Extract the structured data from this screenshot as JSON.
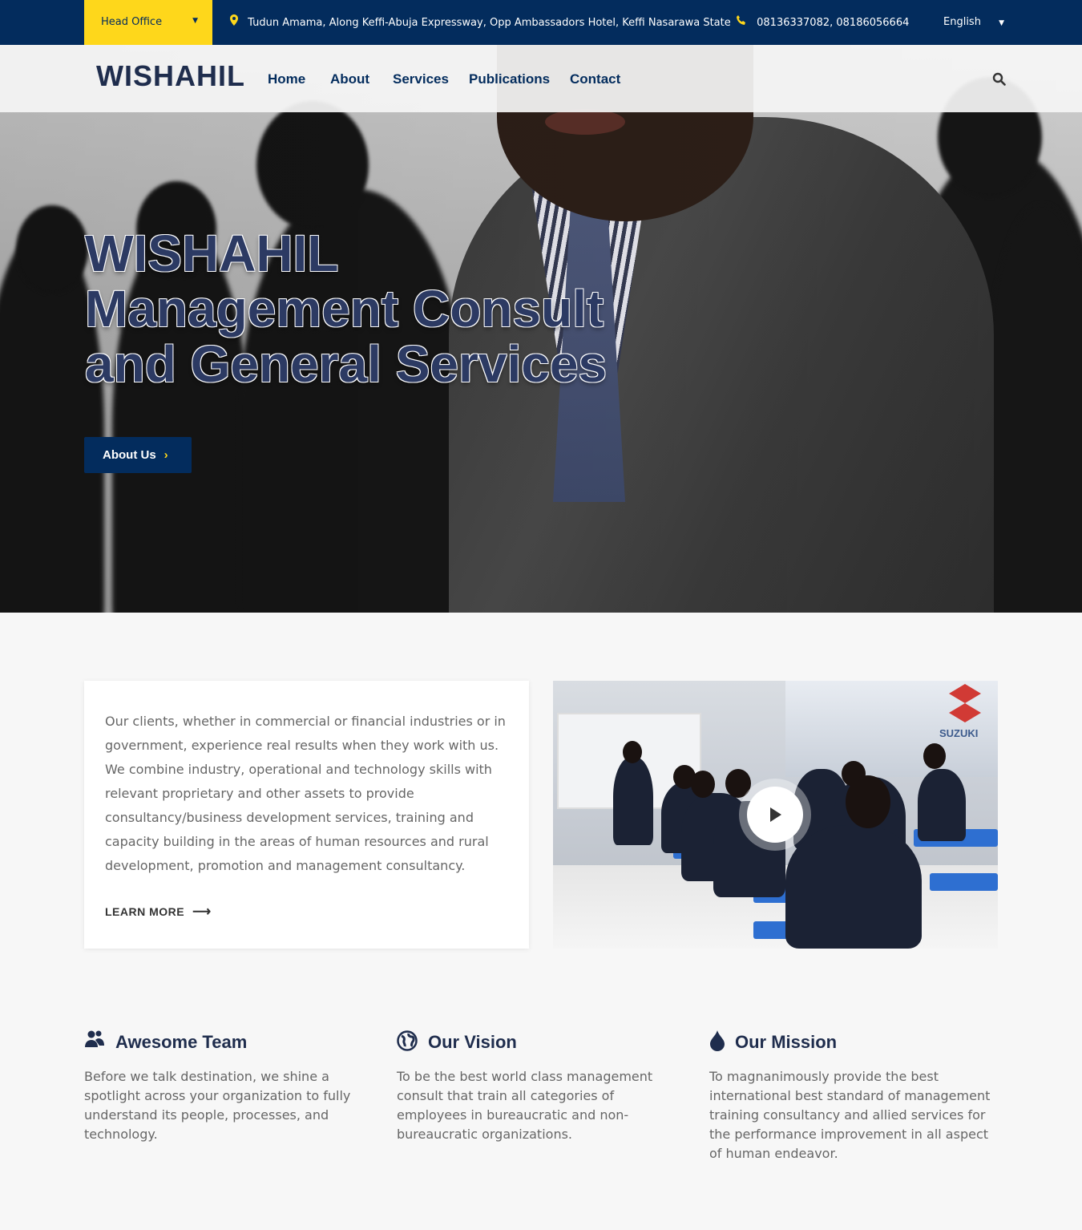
{
  "topbar": {
    "office": "Head Office",
    "address": "Tudun Amama, Along Keffi-Abuja Expressway, Opp Ambassadors Hotel, Keffi Nasarawa State",
    "phone": "08136337082, 08186056664",
    "language": "English"
  },
  "nav": {
    "logo": "WISHAHIL",
    "items": [
      "Home",
      "About",
      "Services",
      "Publications",
      "Contact"
    ]
  },
  "hero": {
    "title_lines": [
      "WISHAHIL",
      "Management Consult",
      "and General Services"
    ],
    "button": "About Us"
  },
  "intro": {
    "text": "Our clients, whether in commercial or financial industries or in government, experience real results when they work with us. We combine industry, operational and technology skills with relevant proprietary and other assets to provide consultancy/business development services, training and capacity building in the areas of human resources and rural development, promotion and management consultancy.",
    "link": "LEARN MORE",
    "video_brand": "SUZUKI"
  },
  "features": [
    {
      "icon": "team-icon",
      "title": "Awesome Team",
      "text": "Before we talk destination, we shine a spotlight across your organization to fully understand its people, processes, and technology."
    },
    {
      "icon": "globe-icon",
      "title": "Our Vision",
      "text": "To be the best world class management consult that train all categories of employees in bureaucratic and non-bureaucratic organizations."
    },
    {
      "icon": "drop-icon",
      "title": "Our Mission",
      "text": "To magnanimously provide the best international best standard of management training consultancy and allied services for the performance improvement in all aspect of human endeavor."
    }
  ],
  "colors": {
    "navy": "#032c5d",
    "yellow": "#fed71b",
    "heading": "#1f2d4d"
  }
}
